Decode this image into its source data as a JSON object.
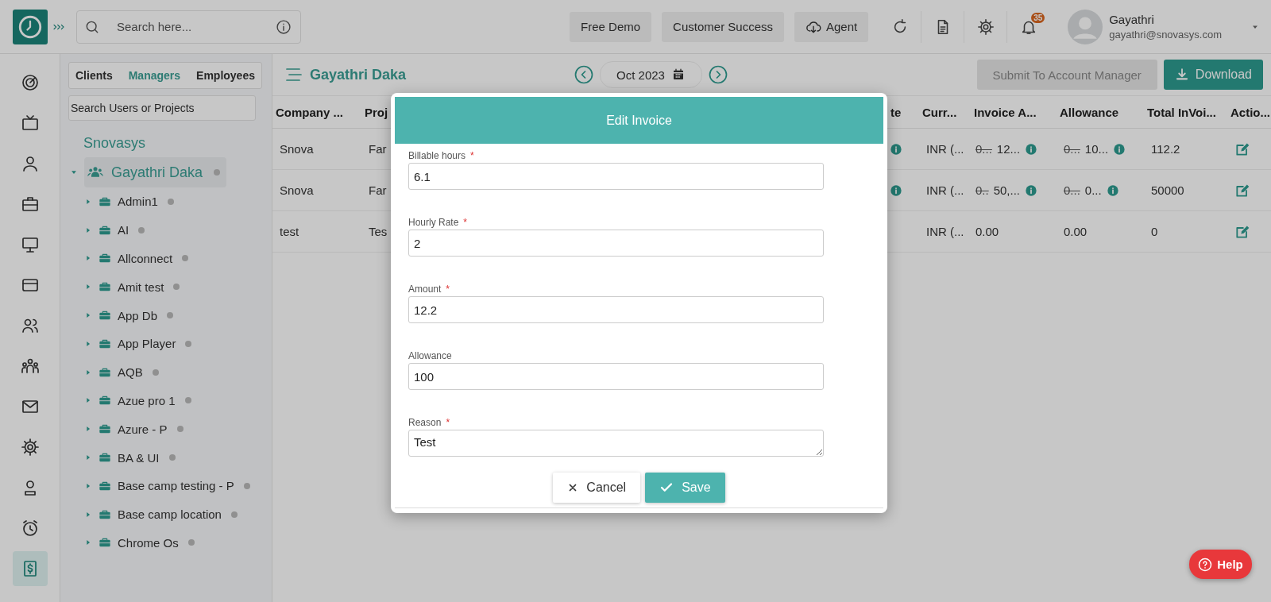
{
  "topbar": {
    "search": {
      "placeholder": "Search here..."
    },
    "buttons": [
      {
        "label": "Free Demo",
        "kind": "plain"
      },
      {
        "label": "Customer Success",
        "kind": "plain"
      },
      {
        "label": "Agent",
        "kind": "cloud"
      }
    ],
    "tools": [
      {
        "kind": "refresh"
      },
      {
        "kind": "document"
      },
      {
        "kind": "settings"
      },
      {
        "kind": "bell",
        "badge": "35"
      }
    ],
    "user": {
      "name": "Gayathri",
      "email": "gayathri@snovasys.com"
    }
  },
  "rail": [
    {
      "kind": "target",
      "selected": false
    },
    {
      "kind": "tv",
      "selected": false
    },
    {
      "kind": "user",
      "selected": false
    },
    {
      "kind": "briefcase",
      "selected": false
    },
    {
      "kind": "monitor",
      "selected": false
    },
    {
      "kind": "card",
      "selected": false
    },
    {
      "kind": "users",
      "selected": false
    },
    {
      "kind": "team",
      "selected": false
    },
    {
      "kind": "mail",
      "selected": false
    },
    {
      "kind": "settings",
      "selected": false
    },
    {
      "kind": "badge",
      "selected": false
    },
    {
      "kind": "alarm",
      "selected": false
    },
    {
      "kind": "invoice",
      "selected": true
    }
  ],
  "tree": {
    "tabs": [
      {
        "label": "Clients",
        "selected": false
      },
      {
        "label": "Managers",
        "selected": true
      },
      {
        "label": "Employees",
        "selected": false
      }
    ],
    "search": {
      "placeholder": "Search Users or Projects"
    },
    "root": "Snovasys",
    "nodes": [
      {
        "label": "Gayathri Daka",
        "kind": "manager",
        "expanded": true,
        "selected": true,
        "children": [
          {
            "label": "Admin1",
            "kind": "project",
            "expanded": false
          },
          {
            "label": "AI",
            "kind": "project",
            "expanded": false
          },
          {
            "label": "Allconnect",
            "kind": "project",
            "expanded": false
          },
          {
            "label": "Amit test",
            "kind": "project",
            "expanded": false
          },
          {
            "label": "App Db",
            "kind": "project",
            "expanded": false
          },
          {
            "label": "App Player",
            "kind": "project",
            "expanded": false
          },
          {
            "label": "AQB",
            "kind": "project",
            "expanded": false
          },
          {
            "label": "Azue pro 1",
            "kind": "project",
            "expanded": false
          },
          {
            "label": "Azure - P",
            "kind": "project",
            "expanded": false
          },
          {
            "label": "BA & UI",
            "kind": "project",
            "expanded": false
          },
          {
            "label": "Base camp testing - P",
            "kind": "project",
            "expanded": false
          },
          {
            "label": "Base camp location",
            "kind": "project",
            "expanded": false
          },
          {
            "label": "Chrome Os",
            "kind": "project",
            "expanded": false
          }
        ]
      }
    ]
  },
  "header": {
    "title": "Gayathri Daka",
    "month": "Oct 2023",
    "submit": {
      "label": "Submit To Account Manager",
      "disabled": true
    },
    "download": {
      "label": "Download"
    }
  },
  "table": {
    "columns": [
      {
        "label": "Company ..."
      },
      {
        "label": "Proj"
      },
      {
        "label": "te"
      },
      {
        "label": "Curr..."
      },
      {
        "label": "Invoice A..."
      },
      {
        "label": "Allowance"
      },
      {
        "label": "Total InVoi..."
      },
      {
        "label": "Actio..."
      }
    ],
    "rows": [
      {
        "company": "Snova",
        "project": "Far",
        "rate_info": true,
        "currency": "INR (...",
        "invoice": {
          "old": "0...",
          "new": "12...",
          "info": true
        },
        "allowance": {
          "old": "0...",
          "new": "10...",
          "info": true
        },
        "total": "112.2"
      },
      {
        "company": "Snova",
        "project": "Far",
        "rate_info": true,
        "currency": "INR (...",
        "invoice": {
          "old": "0..",
          "new": "50,...",
          "info": true
        },
        "allowance": {
          "old": "0...",
          "new": "0...",
          "info": true
        },
        "total": "50000"
      },
      {
        "company": "test",
        "project": "Tes",
        "rate_info": false,
        "currency": "INR (...",
        "invoice": {
          "new": "0.00",
          "info": false
        },
        "allowance": {
          "new": "0.00",
          "info": false
        },
        "total": "0"
      }
    ]
  },
  "modal": {
    "title": "Edit Invoice",
    "fields": [
      {
        "label": "Billable hours",
        "mark": "*",
        "value": "6.1",
        "kind": "input"
      },
      {
        "label": "Hourly Rate",
        "mark": "*",
        "value": "2",
        "kind": "input"
      },
      {
        "label": "Amount",
        "mark": "*",
        "value": "12.2",
        "kind": "input"
      },
      {
        "label": "Allowance",
        "value": "100",
        "kind": "input"
      },
      {
        "label": "Reason",
        "mark": "*",
        "value": "Test",
        "kind": "textarea"
      }
    ],
    "buttons": [
      {
        "label": "Cancel",
        "kind": "cancel"
      },
      {
        "label": "Save",
        "kind": "save"
      }
    ]
  },
  "help": {
    "label": "Help"
  }
}
